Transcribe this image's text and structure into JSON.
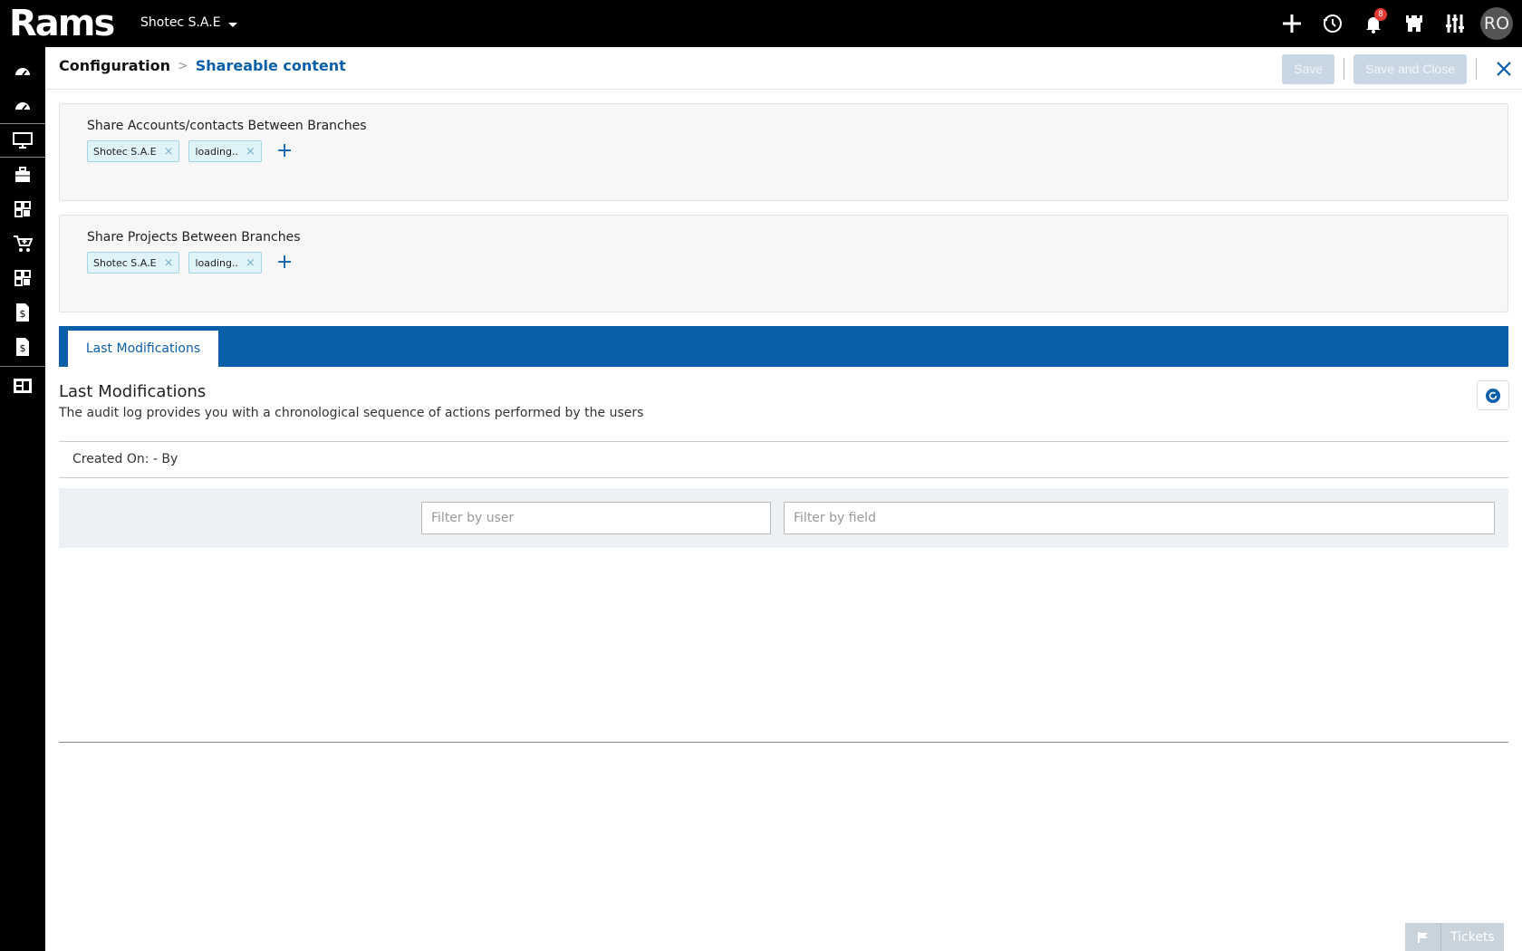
{
  "app": {
    "logo_text": "Rams",
    "company": "Shotec S.A.E",
    "notifications_count": "8",
    "avatar_initials": "RO"
  },
  "breadcrumb": {
    "root": "Configuration",
    "separator": ">",
    "current": "Shareable content"
  },
  "toolbar": {
    "save_label": "Save",
    "save_close_label": "Save and Close"
  },
  "panels": [
    {
      "title": "Share Accounts/contacts Between Branches",
      "chips": [
        "Shotec S.A.E",
        "loading.."
      ]
    },
    {
      "title": "Share Projects Between Branches",
      "chips": [
        "Shotec S.A.E",
        "loading.."
      ]
    }
  ],
  "tabs": [
    {
      "label": "Last Modifications",
      "active": true
    }
  ],
  "last_modifications": {
    "title": "Last Modifications",
    "description": "The audit log provides you with a chronological sequence of actions performed by the users",
    "created_on": "Created On: - By",
    "filter_user_placeholder": "Filter by user",
    "filter_field_placeholder": "Filter by field"
  },
  "tickets": {
    "label": "Tickets"
  },
  "sidebar": {
    "items": [
      "dashboard-icon",
      "dashboard-alt-icon",
      "monitor-icon",
      "briefcase-icon",
      "modules-icon",
      "cart-icon",
      "modules-alt-icon",
      "invoice-icon",
      "invoice-alt-icon",
      "reports-icon"
    ]
  },
  "colors": {
    "accent": "#0b5fa8",
    "topbar": "#000000",
    "badge": "#e53935"
  }
}
